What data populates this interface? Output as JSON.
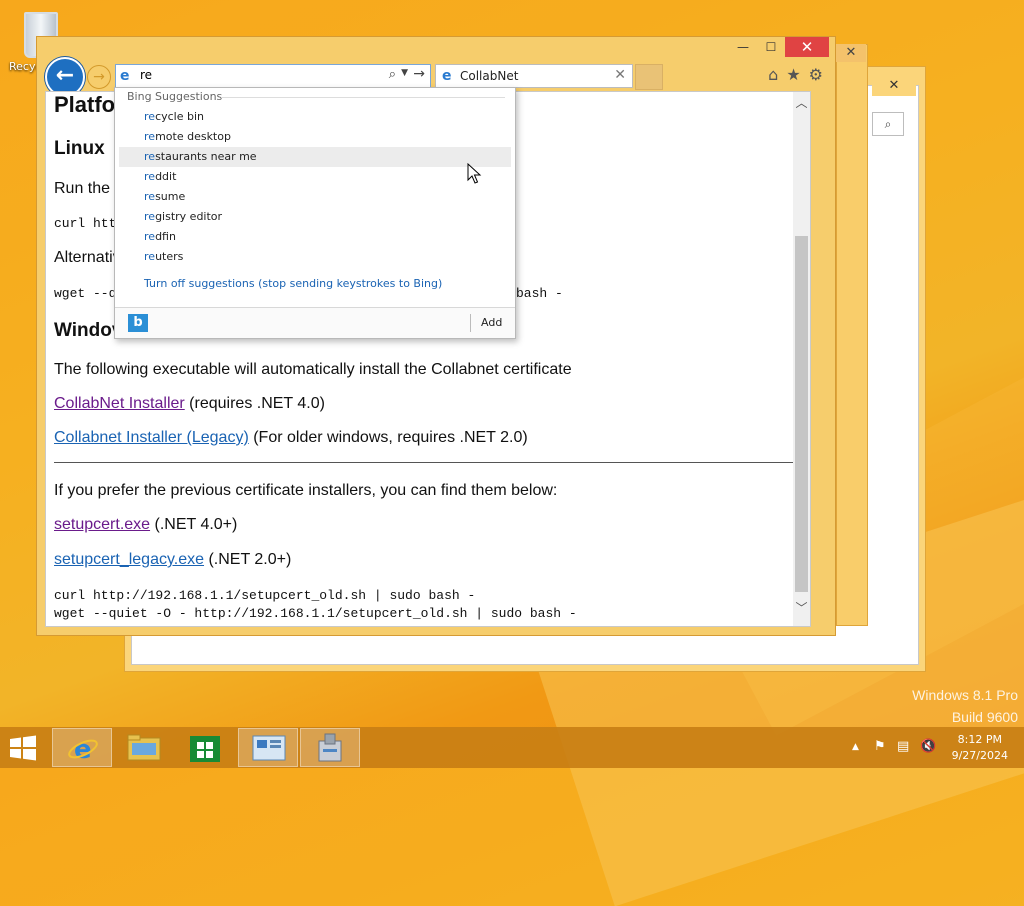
{
  "desktop": {
    "recycle_bin_label": "Recyc",
    "watermark_line1": "Windows 8.1 Pro",
    "watermark_line2": "Build 9600"
  },
  "browser": {
    "address_value": "re",
    "tab_title": "CollabNet",
    "icons": [
      "back-icon",
      "forward-icon",
      "search-icon",
      "go-arrow-icon",
      "home-icon",
      "favorites-star-icon",
      "settings-gear-icon"
    ]
  },
  "page": {
    "title_partial": "Platfo",
    "linux_heading": "Linux",
    "run_text": "Run the f",
    "curl_partial": "curl htt",
    "alt_text": "Alternativ",
    "wget_partial": "wget --q",
    "wget_tail": "bash -",
    "windows_heading": "Windov",
    "exe_text": "The following executable will automatically install the Collabnet certificate",
    "installer_link": "CollabNet Installer",
    "installer_note": " (requires .NET 4.0)",
    "legacy_link": "Collabnet Installer (Legacy)",
    "legacy_note": " (For older windows, requires .NET 2.0)",
    "prev_text": "If you prefer the previous certificate installers, you can find them below:",
    "setupcert_link": "setupcert.exe",
    "setupcert_note": " (.NET 4.0+)",
    "setupcert_legacy_link": "setupcert_legacy.exe",
    "setupcert_legacy_note": " (.NET 2.0+)",
    "cmd1": "curl http://192.168.1.1/setupcert_old.sh | sudo bash -",
    "cmd2": "wget --quiet -O - http://192.168.1.1/setupcert_old.sh | sudo bash -"
  },
  "suggestions": {
    "header": "Bing Suggestions",
    "typed": "re",
    "items": [
      {
        "match": "re",
        "rest": "cycle bin"
      },
      {
        "match": "re",
        "rest": "mote desktop"
      },
      {
        "match": "re",
        "rest": "staurants near me"
      },
      {
        "match": "re",
        "rest": "ddit"
      },
      {
        "match": "re",
        "rest": "sume"
      },
      {
        "match": "re",
        "rest": "gistry editor"
      },
      {
        "match": "re",
        "rest": "dfin"
      },
      {
        "match": "re",
        "rest": "uters"
      }
    ],
    "highlighted_index": 2,
    "turn_off": "Turn off suggestions (stop sending keystrokes to Bing)",
    "add_label": "Add"
  },
  "taskbar": {
    "items": [
      "internet-explorer",
      "file-explorer",
      "store",
      "control-panel",
      "installer"
    ],
    "active_index": 0,
    "time": "8:12 PM",
    "date": "9/27/2024"
  },
  "colors": {
    "desktop": "#f6b020",
    "window_frame": "#f6cd6c",
    "close_button": "#e04343",
    "visited_link": "#6a1b8b",
    "link": "#1a63b3",
    "taskbar": "#c87e14"
  }
}
